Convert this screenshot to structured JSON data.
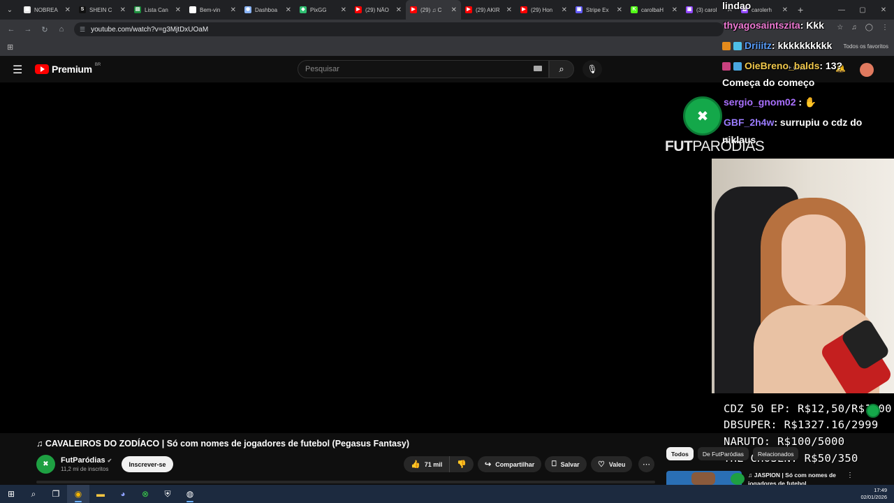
{
  "browser": {
    "tabs": [
      {
        "label": "NOBREA",
        "icon": "n-icon",
        "color": "#e6e6e6",
        "glyph": "▣"
      },
      {
        "label": "SHEIN C",
        "icon": "shein-icon",
        "color": "#111111",
        "glyph": "S"
      },
      {
        "label": "Lista Can",
        "icon": "sheets-icon",
        "color": "#1e8e3e",
        "glyph": "▤"
      },
      {
        "label": "Bem-vin",
        "icon": "notion-icon",
        "color": "#ffffff",
        "glyph": "N"
      },
      {
        "label": "Dashboa",
        "icon": "globe-icon",
        "color": "#8ab4f8",
        "glyph": "◉"
      },
      {
        "label": "PixGG",
        "icon": "pixgg-icon",
        "color": "#2fbf71",
        "glyph": "◆"
      },
      {
        "label": "(29) NÃO",
        "icon": "youtube-icon",
        "color": "#ff0000",
        "glyph": "▶"
      },
      {
        "label": "(29) ♫ C",
        "icon": "youtube-icon",
        "color": "#ff0000",
        "glyph": "▶",
        "active": true
      },
      {
        "label": "(29) AKIR",
        "icon": "youtube-icon",
        "color": "#ff0000",
        "glyph": "▶"
      },
      {
        "label": "(29) Hon",
        "icon": "youtube-icon",
        "color": "#ff0000",
        "glyph": "▶"
      },
      {
        "label": "Stripe Ex",
        "icon": "stripe-icon",
        "color": "#635bff",
        "glyph": "▣"
      },
      {
        "label": "carolbaH",
        "icon": "kick-icon",
        "color": "#53fc18",
        "glyph": "K"
      },
      {
        "label": "(3) carol",
        "icon": "twitch-icon",
        "color": "#9146ff",
        "glyph": "▣"
      },
      {
        "label": "carolerh",
        "icon": "twitch-icon",
        "color": "#9146ff",
        "glyph": "▣"
      }
    ],
    "url": "youtube.com/watch?v=g3MjtDxUOaM",
    "all_favorites": "Todos os favoritos"
  },
  "youtube": {
    "logo_text": "Premium",
    "country_code": "BR",
    "search_placeholder": "Pesquisar",
    "create_label": "Criar",
    "notification_count": "9+",
    "video_title": "♫ CAVALEIROS DO ZODÍACO | Só com nomes de jogadores de futebol (Pegasus Fantasy)",
    "channel_name": "FutParódias",
    "subscribers": "11,2 mi de inscritos",
    "subscribe_label": "Inscrever-se",
    "likes": "71 mil",
    "share_label": "Compartilhar",
    "save_label": "Salvar",
    "thanks_label": "Valeu",
    "chips": [
      "Todos",
      "De FutParódias",
      "Relacionados"
    ],
    "rec_title": "♫ JASPION | Só com nomes de jogadores de futebol"
  },
  "overlay": {
    "chat": [
      {
        "user": "",
        "message": "lindao",
        "color": "#ffffff"
      },
      {
        "user": "thyagosaintszita",
        "message": ": Kkk",
        "color": "#f07bd5"
      },
      {
        "user": "Driiitz",
        "message": ": kkkkkkkkkk",
        "color": "#5aa0ff"
      },
      {
        "user": "OieBreno_balds",
        "message": ": 13?",
        "color": "#f2c94c"
      },
      {
        "user": "",
        "message": "Começa do começo",
        "color": "#ffffff"
      },
      {
        "user": "sergio_gnom02",
        "message": " :",
        "color": "#a970ff"
      },
      {
        "user": "GBF_2h4w",
        "message": ": surrupiu o cdz do",
        "color": "#9b7cff"
      },
      {
        "user": "",
        "message": "niklaus",
        "color": "#ffffff"
      }
    ],
    "brand_bold": "FUT",
    "brand_rest": "PARÓDIAS",
    "goals": [
      "CDZ 50 EP: R$12,50/R$1000",
      "DBSUPER: R$1327.16/2999",
      "NARUTO: R$100/5000",
      "THE CHOSEN: R$50/350"
    ]
  },
  "taskbar": {
    "time": "17:49",
    "date": "02/01/2026"
  }
}
